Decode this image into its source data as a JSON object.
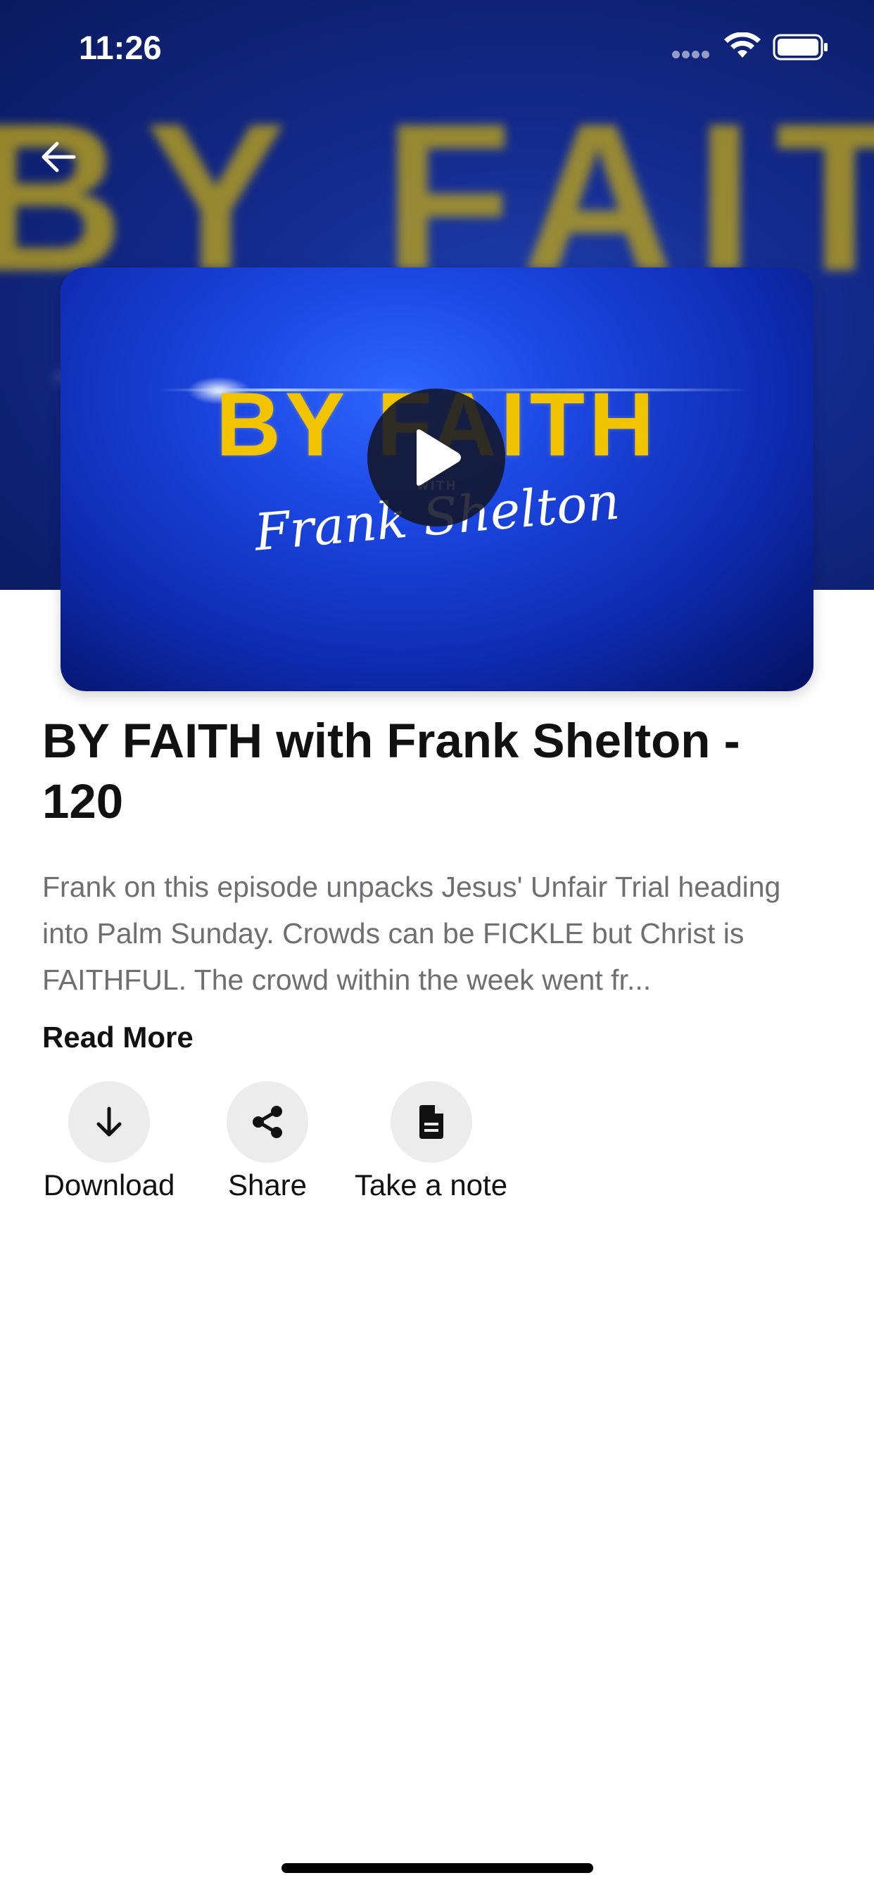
{
  "status_bar": {
    "time": "11:26",
    "wifi_icon": "wifi-icon",
    "battery_icon": "battery-icon"
  },
  "navigation": {
    "back_icon": "arrow-left-icon"
  },
  "hero": {
    "background_text": "BY FAITH"
  },
  "thumbnail": {
    "title": "BY FAITH",
    "with_label": "WITH",
    "script_name": "Frank Shelton",
    "play_icon": "play-icon"
  },
  "episode": {
    "title": "BY FAITH with Frank Shelton - 120",
    "description": "Frank on this episode unpacks Jesus' Unfair Trial heading into Palm Sunday. Crowds can be FICKLE but Christ is FAITHFUL. The crowd within the week went fr...",
    "read_more_label": "Read More"
  },
  "actions": [
    {
      "label": "Download",
      "icon": "arrow-down-icon"
    },
    {
      "label": "Share",
      "icon": "share-icon"
    },
    {
      "label": "Take a note",
      "icon": "document-icon"
    }
  ],
  "colors": {
    "hero_blue": "#13298a",
    "thumbnail_blue": "#1b46e0",
    "title_gold": "#f2c400",
    "action_circle_bg": "#ececec",
    "description_gray": "#6f6f73"
  }
}
